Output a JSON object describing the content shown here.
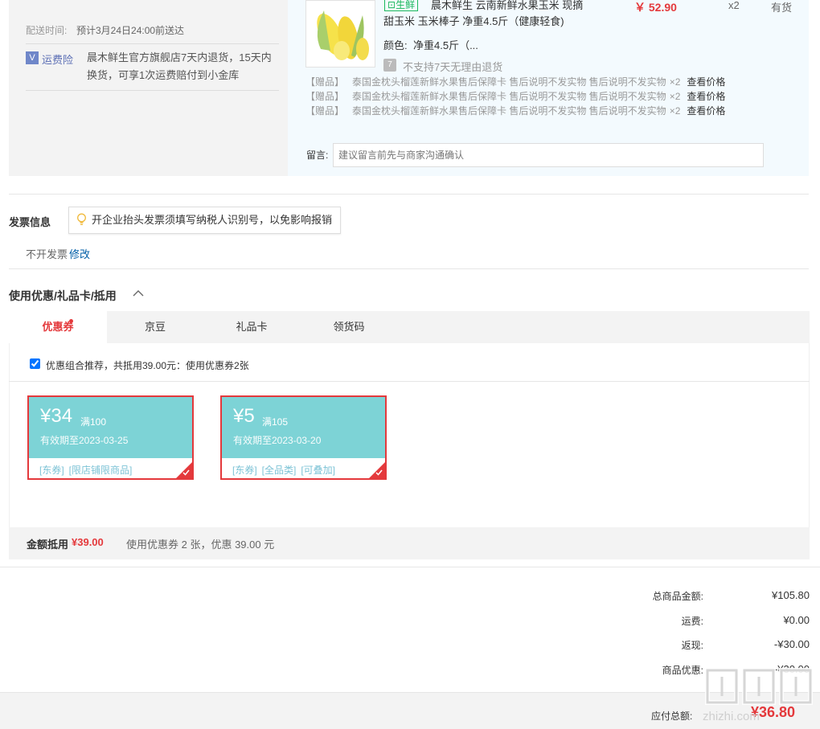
{
  "delivery": {
    "label": "配送时间:",
    "value": "预计3月24日24:00前送达"
  },
  "insurance": {
    "icon_char": "V",
    "label": "运费险",
    "text": "晨木鲜生官方旗舰店7天内退货，15天内换货，可享1次运费赔付到小金库"
  },
  "product": {
    "tag": "生鲜",
    "title": "晨木鲜生 云南新鲜水果玉米 现摘",
    "subtitle": "甜玉米 玉米棒子 净重4.5斤（健康轻食)",
    "price": "￥ 52.90",
    "qty": "x2",
    "stock": "有货",
    "color_label": "颜色:",
    "color_value": "净重4.5斤（...",
    "no_return_icon": "7",
    "no_return": "不支持7天无理由退货"
  },
  "gifts": [
    {
      "label": "【赠品】",
      "title": "泰国金枕头榴莲新鲜水果售后保障卡 售后说明不发实物 售后说明不发实物",
      "qty": "×2",
      "link": "查看价格"
    },
    {
      "label": "【赠品】",
      "title": "泰国金枕头榴莲新鲜水果售后保障卡 售后说明不发实物 售后说明不发实物",
      "qty": "×2",
      "link": "查看价格"
    },
    {
      "label": "【赠品】",
      "title": "泰国金枕头榴莲新鲜水果售后保障卡 售后说明不发实物 售后说明不发实物",
      "qty": "×2",
      "link": "查看价格"
    }
  ],
  "message": {
    "label": "留言:",
    "placeholder": "建议留言前先与商家沟通确认"
  },
  "invoice": {
    "title": "发票信息",
    "tip": "开企业抬头发票须填写纳税人识别号，以免影响报销",
    "status": "不开发票",
    "edit": "修改"
  },
  "coupons": {
    "title": "使用优惠/礼品卡/抵用",
    "tabs": [
      "优惠券",
      "京豆",
      "礼品卡",
      "领货码"
    ],
    "combo_checked": true,
    "combo_text": "优惠组合推荐，共抵用39.00元：使用优惠券2张",
    "items": [
      {
        "amount": "¥34",
        "condition": "满100",
        "expiry": "有效期至2023-03-25",
        "tags": [
          "[东券]",
          "[限店铺限商品]"
        ]
      },
      {
        "amount": "¥5",
        "condition": "满105",
        "expiry": "有效期至2023-03-20",
        "tags": [
          "[东券]",
          "[全品类]",
          "[可叠加]"
        ]
      }
    ],
    "footer_label": "金额抵用",
    "footer_value": "¥39.00",
    "footer_desc": "使用优惠券 2 张，优惠 39.00 元"
  },
  "summary": {
    "rows": [
      {
        "label": "总商品金额:",
        "value": "¥105.80"
      },
      {
        "label": "运费:",
        "value": "¥0.00"
      },
      {
        "label": "返现:",
        "value": "-¥30.00"
      },
      {
        "label": "商品优惠:",
        "value": "-¥30.00"
      }
    ],
    "total_label": "应付总额:",
    "total_value": "¥36.80"
  },
  "colors": {
    "accent_red": "#e4393c",
    "coupon_teal": "#7dd3d6",
    "fresh_green": "#1cb85d",
    "link_blue": "#005ea7"
  }
}
